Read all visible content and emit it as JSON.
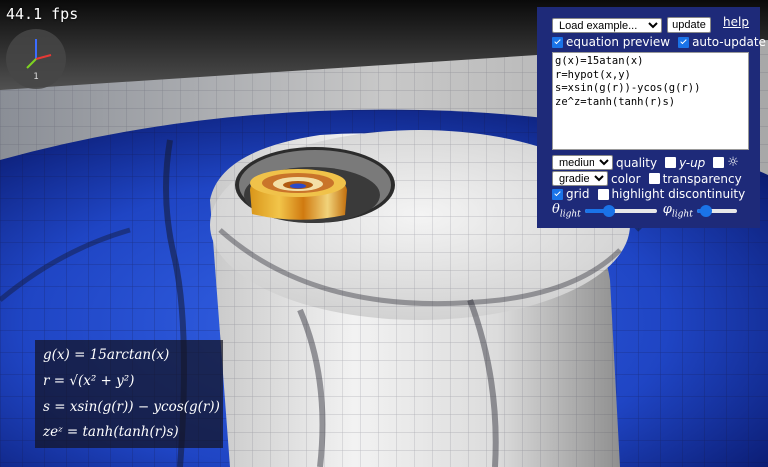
{
  "status": {
    "fps": "44.1 fps"
  },
  "gizmo": {
    "label": "1"
  },
  "panel": {
    "example_select": "Load example...",
    "update_label": "update",
    "help_label": "help",
    "equation_preview_label": "equation preview",
    "auto_update_label": "auto-update",
    "equation_text": "g(x)=15atan(x)\nr=hypot(x,y)\ns=xsin(g(r))-ycos(g(r))\nze^z=tanh(tanh(r)s)",
    "quality_select": "medium",
    "quality_label": "quality",
    "y_up_label": "y-up",
    "light_icon": "☼",
    "color_select": "gradient",
    "color_label": "color",
    "transparency_label": "transparency",
    "grid_label": "grid",
    "highlight_label": "highlight discontinuity",
    "theta_light": {
      "symbol": "θ",
      "sub": "light",
      "value": 0.33
    },
    "phi_light": {
      "symbol": "φ",
      "sub": "light",
      "value": 0.22
    },
    "checkboxes": {
      "equation_preview": true,
      "auto_update": true,
      "y_up": false,
      "light": false,
      "transparency": false,
      "grid": true,
      "highlight": false
    }
  },
  "overlay": {
    "line1": "g(x) = 15arctan(x)",
    "line2": "r = √(x² + y²)",
    "line3": "s = xsin(g(r)) − ycos(g(r))",
    "line4": "zeᶻ = tanh(tanh(r)s)"
  },
  "colors": {
    "panel_bg": "#1e2a79",
    "accent": "#1a73e8",
    "surface_blue": "#1f4fd6"
  }
}
